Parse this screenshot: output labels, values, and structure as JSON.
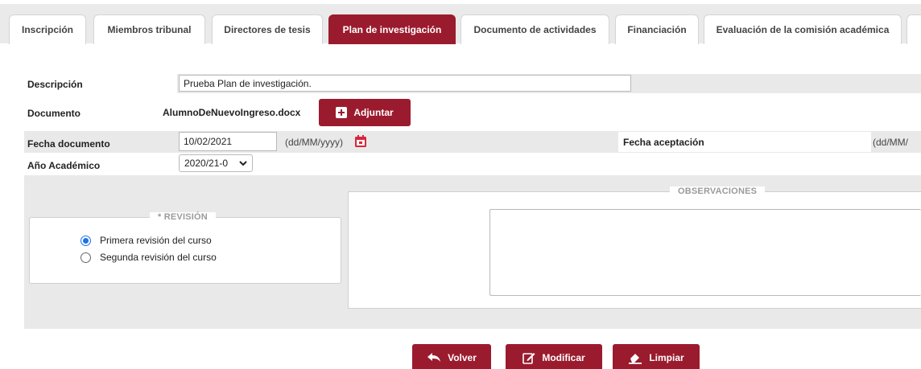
{
  "tabs": [
    {
      "label": "Inscripción",
      "active": false
    },
    {
      "label": "Miembros tribunal",
      "active": false
    },
    {
      "label": "Directores de tesis",
      "active": false
    },
    {
      "label": "Plan de investigación",
      "active": true
    },
    {
      "label": "Documento de actividades",
      "active": false
    },
    {
      "label": "Financiación",
      "active": false
    },
    {
      "label": "Evaluación de la comisión académica",
      "active": false
    }
  ],
  "form": {
    "descripcion_label": "Descripción",
    "descripcion_value": "Prueba Plan de investigación.",
    "documento_label": "Documento",
    "documento_filename": "AlumnoDeNuevoIngreso.docx",
    "adjuntar_label": "Adjuntar",
    "fecha_documento_label": "Fecha documento",
    "fecha_documento_value": "10/02/2021",
    "fecha_format_hint": "(dd/MM/yyyy)",
    "fecha_aceptacion_label": "Fecha aceptación",
    "fecha_aceptacion_hint": "(dd/MM/",
    "anio_academico_label": "Año Académico",
    "anio_academico_value": "2020/21-0"
  },
  "revision": {
    "legend": "* REVISIÓN",
    "options": [
      {
        "label": "Primera revisión del curso",
        "checked": true
      },
      {
        "label": "Segunda revisión del curso",
        "checked": false
      }
    ]
  },
  "observaciones": {
    "legend": "OBSERVACIONES",
    "value": ""
  },
  "actions": {
    "volver": "Volver",
    "modificar": "Modificar",
    "limpiar": "Limpiar"
  },
  "colors": {
    "accent": "#9b1b2e",
    "row_grey": "#e9e9e9",
    "radio_checked": "#1a73e8"
  }
}
